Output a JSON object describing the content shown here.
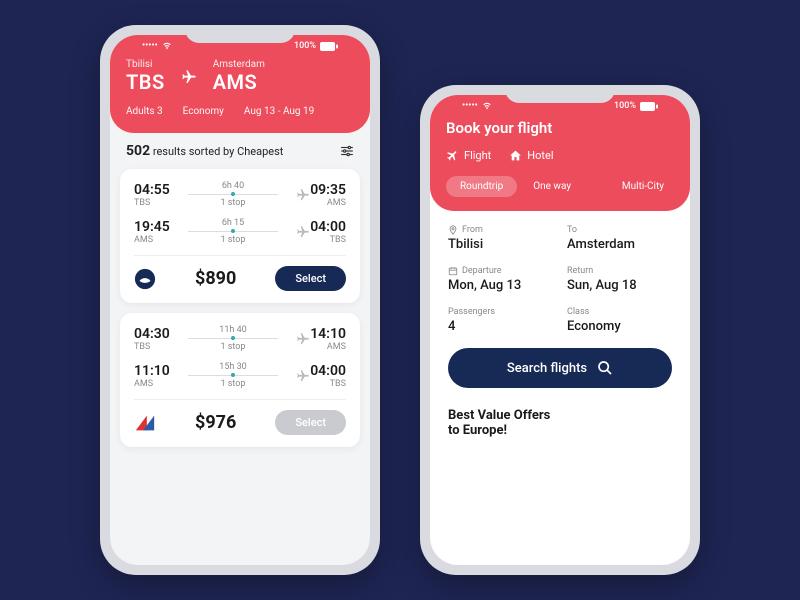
{
  "status": {
    "battery": "100%"
  },
  "left": {
    "from_city": "Tbilisi",
    "from_code": "TBS",
    "to_city": "Amsterdam",
    "to_code": "AMS",
    "pax": "Adults 3",
    "cabin": "Economy",
    "dates": "Aug 13 - Aug 19",
    "results_count": "502",
    "results_text": "results sorted by Cheapest",
    "offers": [
      {
        "legs": [
          {
            "dep_time": "04:55",
            "dep_code": "TBS",
            "duration": "6h 40",
            "stops": "1 stop",
            "arr_time": "09:35",
            "arr_code": "AMS"
          },
          {
            "dep_time": "19:45",
            "dep_code": "AMS",
            "duration": "6h 15",
            "stops": "1 stop",
            "arr_time": "04:00",
            "arr_code": "TBS"
          }
        ],
        "price": "$890",
        "select": "Select"
      },
      {
        "legs": [
          {
            "dep_time": "04:30",
            "dep_code": "TBS",
            "duration": "11h 40",
            "stops": "1 stop",
            "arr_time": "14:10",
            "arr_code": "AMS"
          },
          {
            "dep_time": "11:10",
            "dep_code": "AMS",
            "duration": "15h 30",
            "stops": "1 stop",
            "arr_time": "04:00",
            "arr_code": "TBS"
          }
        ],
        "price": "$976",
        "select": "Select"
      }
    ]
  },
  "right": {
    "title": "Book your flight",
    "tab_flight": "Flight",
    "tab_hotel": "Hotel",
    "trip_round": "Roundtrip",
    "trip_one": "One way",
    "trip_multi": "Multi-City",
    "from_label": "From",
    "from_value": "Tbilisi",
    "to_label": "To",
    "to_value": "Amsterdam",
    "dep_label": "Departure",
    "dep_value": "Mon, Aug 13",
    "ret_label": "Return",
    "ret_value": "Sun, Aug 18",
    "pax_label": "Passengers",
    "pax_value": "4",
    "class_label": "Class",
    "class_value": "Economy",
    "search": "Search flights",
    "promo": "Best Value Offers\nto Europe!"
  }
}
